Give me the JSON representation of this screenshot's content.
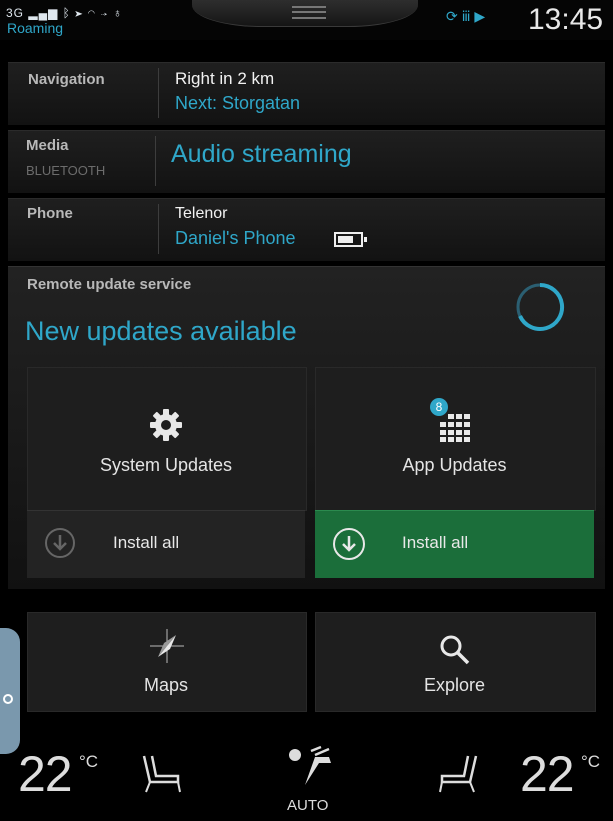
{
  "status_bar": {
    "left_icons_text": "3G",
    "roaming": "Roaming",
    "right_icons_text": "⟳ ⅲ ▶",
    "time": "13:45"
  },
  "navigation": {
    "label": "Navigation",
    "line1": "Right in 2 km",
    "line2": "Next: Storgatan"
  },
  "media": {
    "label": "Media",
    "sublabel": "BLUETOOTH",
    "line1": "Audio streaming"
  },
  "phone": {
    "label": "Phone",
    "line1": "Telenor",
    "line2": "Daniel's Phone"
  },
  "remote_update": {
    "title": "Remote update service",
    "headline": "New updates available",
    "system_updates": {
      "label": "System Updates",
      "install_label": "Install all"
    },
    "app_updates": {
      "label": "App Updates",
      "badge": "8",
      "install_label": "Install all"
    }
  },
  "apps": {
    "maps": "Maps",
    "explore": "Explore"
  },
  "climate": {
    "left_temp": "22",
    "right_temp": "22",
    "unit": "°C",
    "fan_mode": "AUTO"
  },
  "colors": {
    "accent": "#2fa7c9",
    "install_active": "#1b6e3a",
    "background": "#000000"
  }
}
